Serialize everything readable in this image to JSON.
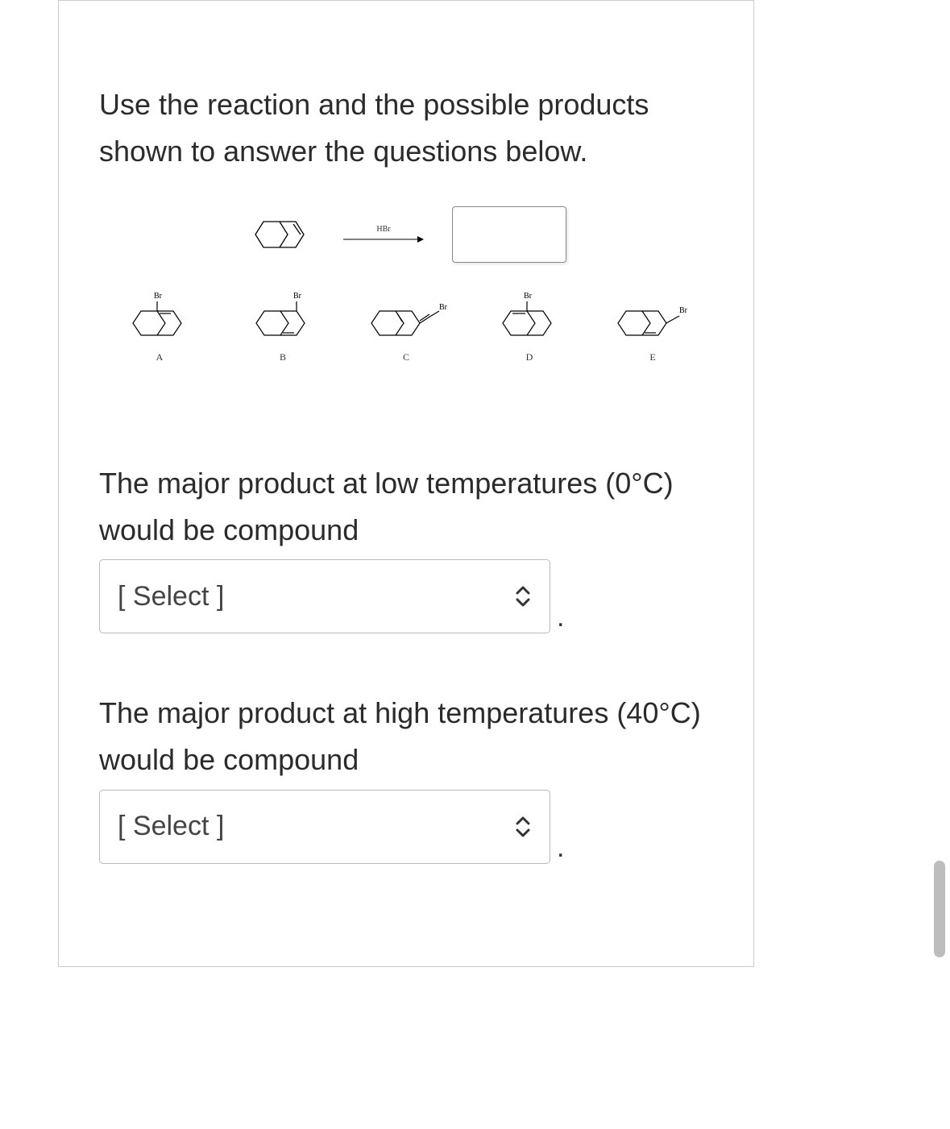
{
  "intro": "Use the reaction and the possible products shown to answer the questions below.",
  "reaction": {
    "reagent": "HBr",
    "product_box": ""
  },
  "products": {
    "A": {
      "label": "A",
      "br": "Br"
    },
    "B": {
      "label": "B",
      "br": "Br"
    },
    "C": {
      "label": "C",
      "br": "Br"
    },
    "D": {
      "label": "D",
      "br": "Br"
    },
    "E": {
      "label": "E",
      "br": "Br"
    }
  },
  "q1": {
    "text": "The major product at low temperatures (0°C) would be compound",
    "select_placeholder": "[ Select ]",
    "period": "."
  },
  "q2": {
    "text": "The major product at high temperatures (40°C) would be compound",
    "select_placeholder": "[ Select ]",
    "period": "."
  }
}
